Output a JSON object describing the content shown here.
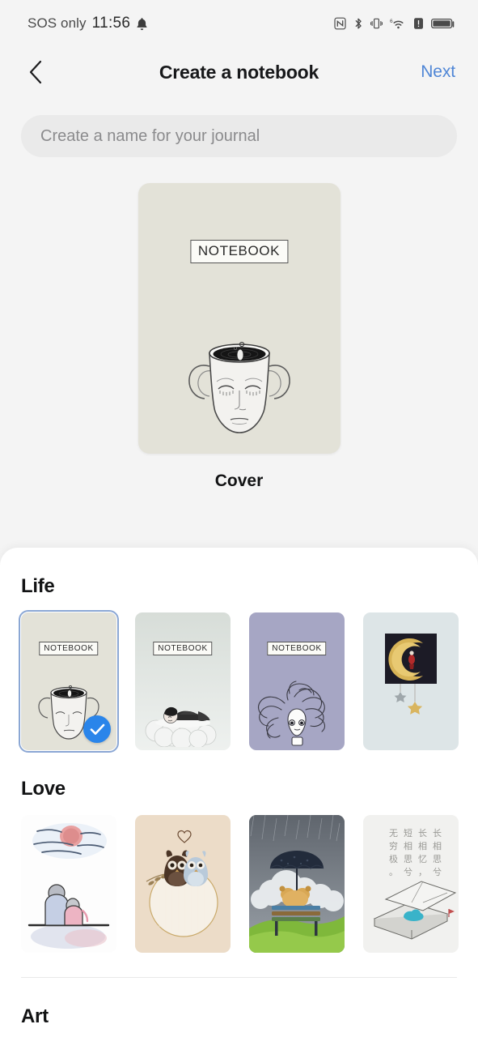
{
  "statusbar": {
    "carrier": "SOS only",
    "time": "11:56",
    "icons": [
      "bell-icon",
      "nfc-icon",
      "bluetooth-icon",
      "vibrate-icon",
      "wifi-6-icon",
      "alert-icon",
      "battery-icon"
    ]
  },
  "header": {
    "back_icon": "chevron-left-icon",
    "title": "Create a notebook",
    "next_label": "Next"
  },
  "name_field": {
    "placeholder": "Create a name for your journal",
    "value": ""
  },
  "preview": {
    "cover_label": "NOTEBOOK",
    "caption": "Cover",
    "background": "#e3e2d8",
    "art": "face-cup-illustration"
  },
  "accent_color": "#2a85ea",
  "next_color": "#4f86d6",
  "sections": [
    {
      "title": "Life",
      "covers": [
        {
          "label": "NOTEBOOK",
          "art": "face-cup-illustration",
          "background": "#e3e2d8",
          "selected": true
        },
        {
          "label": "NOTEBOOK",
          "art": "sleeping-on-clouds-illustration",
          "background": "#d9e0da",
          "selected": false
        },
        {
          "label": "NOTEBOOK",
          "art": "wild-hair-girl-illustration",
          "background": "#a6a6c4",
          "selected": false
        },
        {
          "label": "",
          "art": "crescent-moon-illustration",
          "background": "#dde5e7",
          "selected": false
        }
      ]
    },
    {
      "title": "Love",
      "covers": [
        {
          "label": "",
          "art": "couple-at-sunset-watercolor",
          "background": "#fdfdfd",
          "selected": false
        },
        {
          "label": "",
          "art": "two-owls-heart-illustration",
          "background": "#ecdcc8",
          "selected": false
        },
        {
          "label": "",
          "art": "teddy-bear-umbrella-bench",
          "background": "#6d7279",
          "selected": false
        },
        {
          "label": "长相思兮 长相忆，短相思兮 无穷极。",
          "art": "open-box-calligraphy",
          "background": "#f1f1ef",
          "selected": false
        }
      ]
    },
    {
      "title": "Art",
      "covers": []
    }
  ]
}
